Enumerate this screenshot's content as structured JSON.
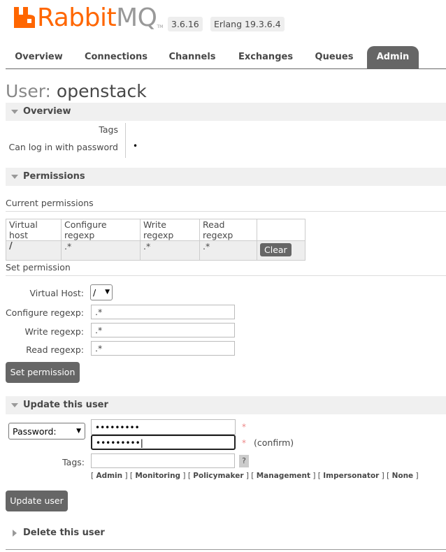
{
  "app": {
    "brand_main": "Rabbit",
    "brand_accent": "MQ",
    "brand_tm": "TM",
    "version": "3.6.16",
    "erlang": "Erlang 19.3.6.4",
    "brand_color": "#ff6600"
  },
  "tabs": [
    {
      "label": "Overview",
      "active": false
    },
    {
      "label": "Connections",
      "active": false
    },
    {
      "label": "Channels",
      "active": false
    },
    {
      "label": "Exchanges",
      "active": false
    },
    {
      "label": "Queues",
      "active": false
    },
    {
      "label": "Admin",
      "active": true
    }
  ],
  "page": {
    "title_label": "User:",
    "title_value": "openstack"
  },
  "overview": {
    "header": "Overview",
    "tags_label": "Tags",
    "tags_value": "",
    "login_label": "Can log in with password",
    "login_value": "•"
  },
  "permissions": {
    "header": "Permissions",
    "current_title": "Current permissions",
    "columns": [
      "Virtual host",
      "Configure regexp",
      "Write regexp",
      "Read regexp",
      ""
    ],
    "rows": [
      {
        "vhost": "/",
        "configure": ".*",
        "write": ".*",
        "read": ".*",
        "action": "Clear"
      }
    ],
    "set_title": "Set permission",
    "vhost_label": "Virtual Host:",
    "vhost_value": "/",
    "configure_label": "Configure regexp:",
    "configure_value": ".*",
    "write_label": "Write regexp:",
    "write_value": ".*",
    "read_label": "Read regexp:",
    "read_value": ".*",
    "submit": "Set permission"
  },
  "update": {
    "header": "Update this user",
    "password_select": "Password:",
    "password_value": "•••••••••",
    "confirm_value": "•••••••••",
    "required_mark": "*",
    "confirm_label": "(confirm)",
    "tags_label": "Tags:",
    "tags_value": "",
    "help_label": "?",
    "tag_options": [
      "Admin",
      "Monitoring",
      "Policymaker",
      "Management",
      "Impersonator",
      "None"
    ],
    "submit": "Update user"
  },
  "delete": {
    "header": "Delete this user"
  }
}
